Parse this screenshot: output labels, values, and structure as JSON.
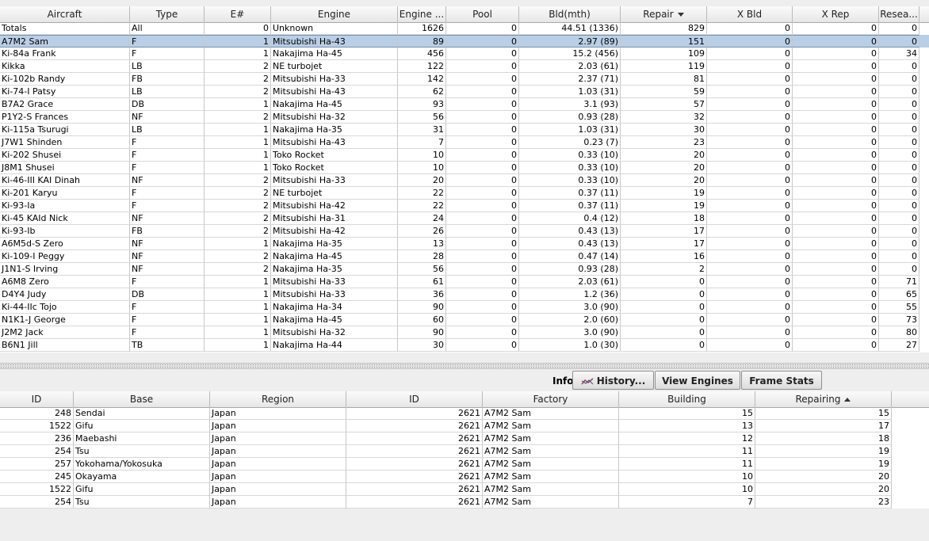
{
  "top_table": {
    "headers": [
      "Aircraft",
      "Type",
      "E#",
      "Engine",
      "Engine ...",
      "Pool",
      "Bld(mth)",
      "Repair",
      "X Bld",
      "X Rep",
      "Resea..."
    ],
    "sorted_column": "Repair",
    "selected_row": 1,
    "rows": [
      [
        "Totals",
        "All",
        "0",
        "Unknown",
        "1626",
        "0",
        "44.51 (1336)",
        "829",
        "0",
        "0",
        "0"
      ],
      [
        "A7M2 Sam",
        "F",
        "1",
        "Mitsubishi Ha-43",
        "89",
        "0",
        "2.97 (89)",
        "151",
        "0",
        "0",
        "0"
      ],
      [
        "Ki-84a Frank",
        "F",
        "1",
        "Nakajima Ha-45",
        "456",
        "0",
        "15.2 (456)",
        "109",
        "0",
        "0",
        "34"
      ],
      [
        "Kikka",
        "LB",
        "2",
        "NE turbojet",
        "122",
        "0",
        "2.03 (61)",
        "119",
        "0",
        "0",
        "0"
      ],
      [
        "Ki-102b Randy",
        "FB",
        "2",
        "Mitsubishi Ha-33",
        "142",
        "0",
        "2.37 (71)",
        "81",
        "0",
        "0",
        "0"
      ],
      [
        "Ki-74-I Patsy",
        "LB",
        "2",
        "Mitsubishi Ha-43",
        "62",
        "0",
        "1.03 (31)",
        "59",
        "0",
        "0",
        "0"
      ],
      [
        "B7A2 Grace",
        "DB",
        "1",
        "Nakajima Ha-45",
        "93",
        "0",
        "3.1 (93)",
        "57",
        "0",
        "0",
        "0"
      ],
      [
        "P1Y2-S Frances",
        "NF",
        "2",
        "Mitsubishi Ha-32",
        "56",
        "0",
        "0.93 (28)",
        "32",
        "0",
        "0",
        "0"
      ],
      [
        "Ki-115a Tsurugi",
        "LB",
        "1",
        "Nakajima Ha-35",
        "31",
        "0",
        "1.03 (31)",
        "30",
        "0",
        "0",
        "0"
      ],
      [
        "J7W1 Shinden",
        "F",
        "1",
        "Mitsubishi Ha-43",
        "7",
        "0",
        "0.23 (7)",
        "23",
        "0",
        "0",
        "0"
      ],
      [
        "Ki-202 Shusei",
        "F",
        "1",
        "Toko Rocket",
        "10",
        "0",
        "0.33 (10)",
        "20",
        "0",
        "0",
        "0"
      ],
      [
        "J8M1 Shusei",
        "F",
        "1",
        "Toko Rocket",
        "10",
        "0",
        "0.33 (10)",
        "20",
        "0",
        "0",
        "0"
      ],
      [
        "Ki-46-III KAI Dinah",
        "NF",
        "2",
        "Mitsubishi Ha-33",
        "20",
        "0",
        "0.33 (10)",
        "20",
        "0",
        "0",
        "0"
      ],
      [
        "Ki-201 Karyu",
        "F",
        "2",
        "NE turbojet",
        "22",
        "0",
        "0.37 (11)",
        "19",
        "0",
        "0",
        "0"
      ],
      [
        "Ki-93-Ia",
        "F",
        "2",
        "Mitsubishi Ha-42",
        "22",
        "0",
        "0.37 (11)",
        "19",
        "0",
        "0",
        "0"
      ],
      [
        "Ki-45 KAId Nick",
        "NF",
        "2",
        "Mitsubishi Ha-31",
        "24",
        "0",
        "0.4 (12)",
        "18",
        "0",
        "0",
        "0"
      ],
      [
        "Ki-93-Ib",
        "FB",
        "2",
        "Mitsubishi Ha-42",
        "26",
        "0",
        "0.43 (13)",
        "17",
        "0",
        "0",
        "0"
      ],
      [
        "A6M5d-S Zero",
        "NF",
        "1",
        "Nakajima Ha-35",
        "13",
        "0",
        "0.43 (13)",
        "17",
        "0",
        "0",
        "0"
      ],
      [
        "Ki-109-I Peggy",
        "NF",
        "2",
        "Nakajima Ha-45",
        "28",
        "0",
        "0.47 (14)",
        "16",
        "0",
        "0",
        "0"
      ],
      [
        "J1N1-S Irving",
        "NF",
        "2",
        "Nakajima Ha-35",
        "56",
        "0",
        "0.93 (28)",
        "2",
        "0",
        "0",
        "0"
      ],
      [
        "A6M8 Zero",
        "F",
        "1",
        "Mitsubishi Ha-33",
        "61",
        "0",
        "2.03 (61)",
        "0",
        "0",
        "0",
        "71"
      ],
      [
        "D4Y4 Judy",
        "DB",
        "1",
        "Mitsubishi Ha-33",
        "36",
        "0",
        "1.2 (36)",
        "0",
        "0",
        "0",
        "65"
      ],
      [
        "Ki-44-IIc Tojo",
        "F",
        "1",
        "Nakajima Ha-34",
        "90",
        "0",
        "3.0 (90)",
        "0",
        "0",
        "0",
        "55"
      ],
      [
        "N1K1-J George",
        "F",
        "1",
        "Nakajima Ha-45",
        "60",
        "0",
        "2.0 (60)",
        "0",
        "0",
        "0",
        "73"
      ],
      [
        "J2M2 Jack",
        "F",
        "1",
        "Mitsubishi Ha-32",
        "90",
        "0",
        "3.0 (90)",
        "0",
        "0",
        "0",
        "80"
      ],
      [
        "B6N1 Jill",
        "TB",
        "1",
        "Nakajima Ha-44",
        "30",
        "0",
        "1.0 (30)",
        "0",
        "0",
        "0",
        "27"
      ]
    ]
  },
  "toolbar": {
    "info_label": "Info:",
    "history_label": "History...",
    "view_engines_label": "View Engines",
    "frame_stats_label": "Frame Stats",
    "history_icon": "history-chart-icon"
  },
  "bottom_table": {
    "headers": [
      "ID",
      "Base",
      "Region",
      "ID",
      "Factory",
      "Building",
      "Repairing"
    ],
    "sorted_column": "Repairing",
    "rows": [
      [
        "248",
        "Sendai",
        "Japan",
        "2621",
        "A7M2 Sam",
        "15",
        "15"
      ],
      [
        "1522",
        "Gifu",
        "Japan",
        "2621",
        "A7M2 Sam",
        "13",
        "17"
      ],
      [
        "236",
        "Maebashi",
        "Japan",
        "2621",
        "A7M2 Sam",
        "12",
        "18"
      ],
      [
        "254",
        "Tsu",
        "Japan",
        "2621",
        "A7M2 Sam",
        "11",
        "19"
      ],
      [
        "257",
        "Yokohama/Yokosuka",
        "Japan",
        "2621",
        "A7M2 Sam",
        "11",
        "19"
      ],
      [
        "245",
        "Okayama",
        "Japan",
        "2621",
        "A7M2 Sam",
        "10",
        "20"
      ],
      [
        "1522",
        "Gifu",
        "Japan",
        "2621",
        "A7M2 Sam",
        "10",
        "20"
      ],
      [
        "254",
        "Tsu",
        "Japan",
        "2621",
        "A7M2 Sam",
        "7",
        "23"
      ]
    ]
  }
}
